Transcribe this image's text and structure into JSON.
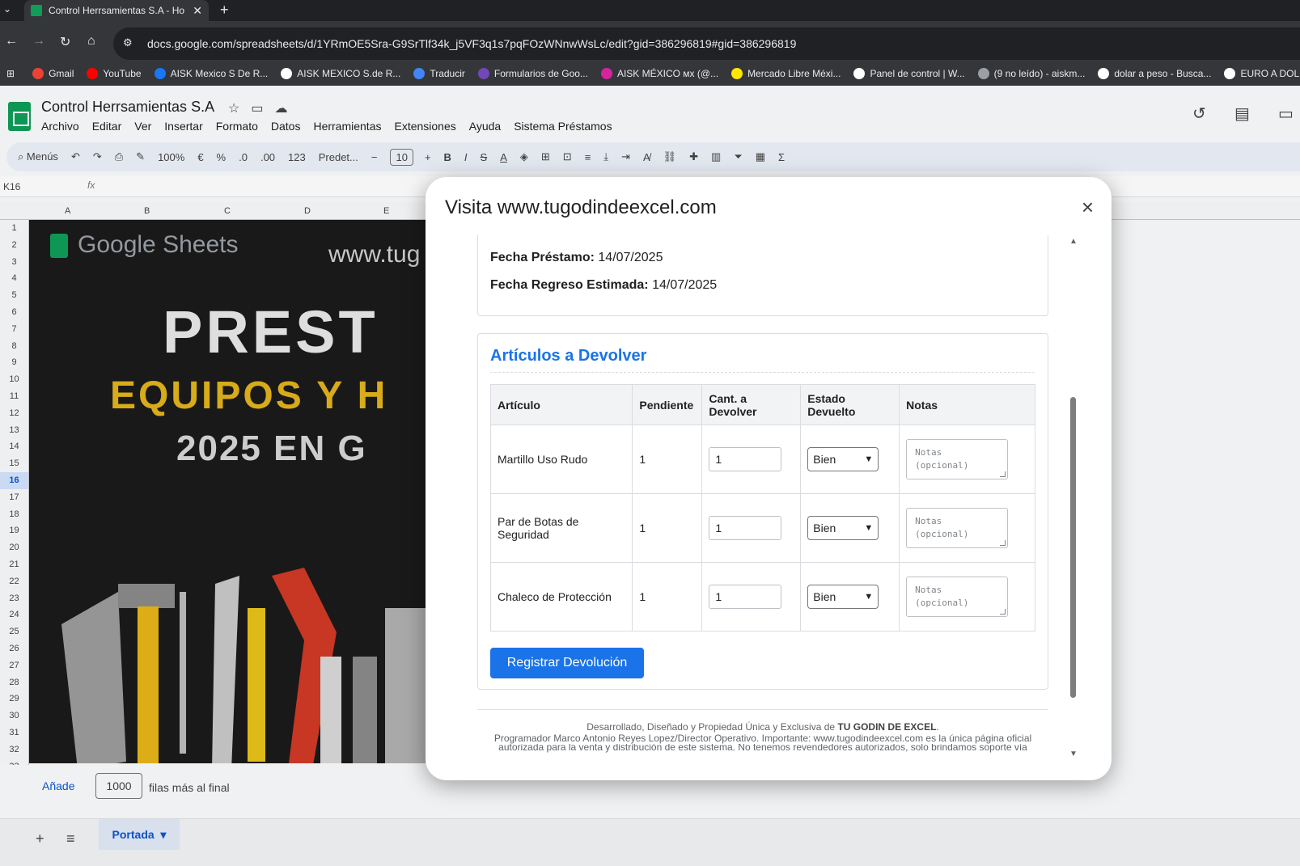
{
  "browser": {
    "tab_title": "Control Herrsamientas S.A - Ho",
    "url": "docs.google.com/spreadsheets/d/1YRmOE5Sra-G9SrTlf34k_j5VF3q1s7pqFOzWNnwWsLc/edit?gid=386296819#gid=386296819",
    "bookmarks": [
      {
        "label": "Gmail",
        "color": "#ea4335"
      },
      {
        "label": "YouTube",
        "color": "#ff0000"
      },
      {
        "label": "AISK Mexico S De R...",
        "color": "#1877f2"
      },
      {
        "label": "AISK MEXICO S.de R...",
        "color": "#ffffff"
      },
      {
        "label": "Traducir",
        "color": "#4285f4"
      },
      {
        "label": "Formularios de Goo...",
        "color": "#7248b9"
      },
      {
        "label": "AISK MÉXICO мх (@...",
        "color": "#d6249f"
      },
      {
        "label": "Mercado Libre Méxi...",
        "color": "#ffe600"
      },
      {
        "label": "Panel de control | W...",
        "color": "#ffffff"
      },
      {
        "label": "(9 no leído) - aiskm...",
        "color": "#9aa0a6"
      },
      {
        "label": "dolar a peso - Busca...",
        "color": "#ffffff"
      },
      {
        "label": "EURO A DOL",
        "color": "#ffffff"
      }
    ]
  },
  "sheets": {
    "doc_title": "Control Herrsamientas S.A",
    "menu": [
      "Archivo",
      "Editar",
      "Ver",
      "Insertar",
      "Formato",
      "Datos",
      "Herramientas",
      "Extensiones",
      "Ayuda",
      "Sistema Préstamos"
    ],
    "toolbar": {
      "search": "Menús",
      "zoom": "100%",
      "currency": "€",
      "percent": "%",
      "dec_less": ".0",
      "dec_more": ".00",
      "num": "123",
      "font": "Predet...",
      "font_size": "10"
    },
    "name_box": "K16",
    "fx": "fx",
    "columns": [
      "A",
      "B",
      "C",
      "D",
      "E"
    ],
    "rows": [
      "1",
      "2",
      "3",
      "4",
      "5",
      "6",
      "7",
      "8",
      "9",
      "10",
      "11",
      "12",
      "13",
      "14",
      "15",
      "16",
      "17",
      "18",
      "19",
      "20",
      "21",
      "22",
      "23",
      "24",
      "25",
      "26",
      "27",
      "28",
      "29",
      "30",
      "31",
      "32",
      "33"
    ],
    "selected_row": "16",
    "canvas": {
      "brand": "Google Sheets",
      "url_partial": "www.tug",
      "headline1": "PREST",
      "headline2": "EQUIPOS Y H",
      "headline3": "2025 EN G"
    },
    "footer": {
      "add": "Añade",
      "rows_count": "1000",
      "rows_label": "filas más al final",
      "sheet_tab": "Portada"
    }
  },
  "modal": {
    "title": "Visita www.tugodindeexcel.com",
    "close_label": "×",
    "loan": {
      "fecha_prestamo_label": "Fecha Préstamo:",
      "fecha_prestamo_value": "14/07/2025",
      "fecha_regreso_label": "Fecha Regreso Estimada:",
      "fecha_regreso_value": "14/07/2025"
    },
    "section_title": "Artículos a Devolver",
    "table": {
      "headers": [
        "Artículo",
        "Pendiente",
        "Cant. a Devolver",
        "Estado Devuelto",
        "Notas"
      ],
      "rows": [
        {
          "articulo": "Martillo Uso Rudo",
          "pendiente": "1",
          "cantidad": "1",
          "estado": "Bien",
          "notas_placeholder": "Notas (opcional)"
        },
        {
          "articulo": "Par de Botas de Seguridad",
          "pendiente": "1",
          "cantidad": "1",
          "estado": "Bien",
          "notas_placeholder": "Notas (opcional)"
        },
        {
          "articulo": "Chaleco de Protección",
          "pendiente": "1",
          "cantidad": "1",
          "estado": "Bien",
          "notas_placeholder": "Notas (opcional)"
        }
      ]
    },
    "submit_label": "Registrar Devolución",
    "footer": {
      "line1_prefix": "Desarrollado, Diseñado y Propiedad Única y Exclusiva de ",
      "line1_brand": "TU GODIN DE EXCEL",
      "line1_suffix": ".",
      "line2": "Programador Marco Antonio Reyes Lopez/Director Operativo. Importante: www.tugodindeexcel.com es la única página oficial",
      "line3": "autorizada para la venta y distribución de este sistema. No tenemos revendedores autorizados, solo brindamos soporte vía"
    }
  },
  "colors": {
    "accent": "#1a73e8",
    "sheets_green": "#0f9d58",
    "chrome_dark": "#35363a"
  }
}
